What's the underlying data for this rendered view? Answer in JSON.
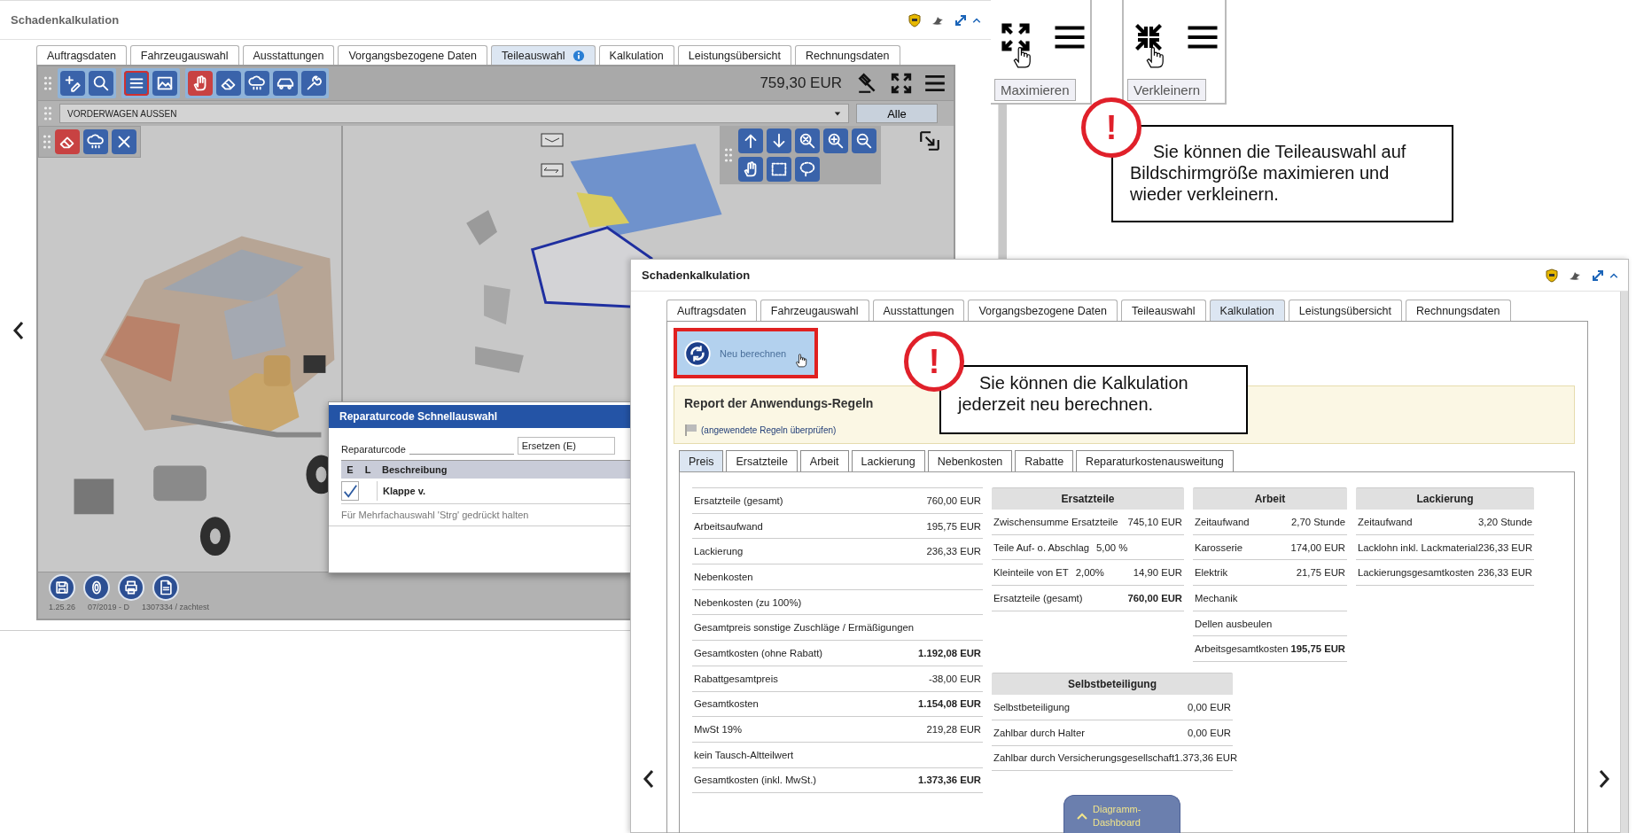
{
  "back_window": {
    "title": "Schadenkalkulation",
    "tabs": [
      {
        "label": "Auftragsdaten",
        "selected": false,
        "info": false
      },
      {
        "label": "Fahrzeugauswahl",
        "selected": false,
        "info": false
      },
      {
        "label": "Ausstattungen",
        "selected": false,
        "info": false
      },
      {
        "label": "Vorgangsbezogene Daten",
        "selected": false,
        "info": false
      },
      {
        "label": "Teileauswahl",
        "selected": true,
        "info": true
      },
      {
        "label": "Kalkulation",
        "selected": false,
        "info": false
      },
      {
        "label": "Leistungsübersicht",
        "selected": false,
        "info": false
      },
      {
        "label": "Rechnungsdaten",
        "selected": false,
        "info": false
      }
    ],
    "toolbar": {
      "groups": [
        {
          "tools": [
            {
              "kind": "add-edit",
              "selected": false,
              "active": false
            },
            {
              "kind": "search",
              "selected": false,
              "active": false
            }
          ]
        },
        {
          "tools": [
            {
              "kind": "list",
              "selected": true,
              "active": false
            },
            {
              "kind": "image",
              "selected": false,
              "active": false
            }
          ]
        },
        {
          "tools": [
            {
              "kind": "hand",
              "selected": false,
              "active": true
            },
            {
              "kind": "eraser",
              "selected": false,
              "active": false
            },
            {
              "kind": "cloud",
              "selected": false,
              "active": false
            },
            {
              "kind": "car",
              "selected": false,
              "active": false
            },
            {
              "kind": "wrench",
              "selected": false,
              "active": false
            }
          ]
        }
      ],
      "total": "759,30 EUR"
    },
    "filter": {
      "value": "VORDERWAGEN AUSSEN",
      "button": "Alle"
    },
    "canvas": {
      "left_tools": [
        {
          "kind": "eraser",
          "selected": false,
          "active": true
        },
        {
          "kind": "cloud",
          "selected": false,
          "active": false
        },
        {
          "kind": "close",
          "selected": false,
          "active": false
        }
      ],
      "view_tools": [
        {
          "kind": "arrow-up",
          "selected": false,
          "active": false
        },
        {
          "kind": "arrow-down",
          "selected": false,
          "active": false
        },
        {
          "kind": "zoom-fit",
          "selected": false,
          "active": false
        },
        {
          "kind": "zoom-in",
          "selected": false,
          "active": false
        },
        {
          "kind": "zoom-out",
          "selected": false,
          "active": false
        },
        {
          "kind": "hand",
          "selected": false,
          "active": false
        },
        {
          "kind": "select-rect",
          "selected": false,
          "active": false
        },
        {
          "kind": "lasso",
          "selected": false,
          "active": false
        }
      ]
    },
    "footer": {
      "tools": [
        {
          "kind": "save"
        },
        {
          "kind": "tire"
        },
        {
          "kind": "print"
        },
        {
          "kind": "document"
        }
      ],
      "status": [
        "1.25.26",
        "07/2019 - D",
        "1307334 / zachtest"
      ]
    },
    "dialog": {
      "title": "Reparaturcode Schnellauswahl",
      "field_label": "Reparaturcode",
      "field_value": "Ersetzen (E)",
      "columns": [
        "E",
        "L",
        "Beschreibung"
      ],
      "rows": [
        {
          "e": true,
          "l": false,
          "description": "Klappe v."
        }
      ],
      "hint": "Für Mehrfachauswahl 'Strg' gedrückt halten"
    }
  },
  "insets": [
    {
      "kind": "maximize",
      "tooltip": "Maximieren"
    },
    {
      "kind": "minimize",
      "tooltip": "Verkleinern"
    }
  ],
  "callouts": [
    {
      "mark": "!",
      "text": "Sie können die Teileauswahl auf Bildschirmgröße maximieren und wieder verkleinern."
    },
    {
      "mark": "!",
      "text": "Sie können die Kalkulation jederzeit neu berechnen."
    }
  ],
  "front_window": {
    "title": "Schadenkalkulation",
    "tabs": [
      {
        "label": "Auftragsdaten",
        "selected": false
      },
      {
        "label": "Fahrzeugauswahl",
        "selected": false
      },
      {
        "label": "Ausstattungen",
        "selected": false
      },
      {
        "label": "Vorgangsbezogene Daten",
        "selected": false
      },
      {
        "label": "Teileauswahl",
        "selected": false
      },
      {
        "label": "Kalkulation",
        "selected": true
      },
      {
        "label": "Leistungsübersicht",
        "selected": false
      },
      {
        "label": "Rechnungsdaten",
        "selected": false
      }
    ],
    "recalc_button": "Neu berechnen",
    "report": {
      "title": "Report der Anwendungs-Regeln",
      "link": "(angewendete Regeln überprüfen)"
    },
    "subtabs": [
      {
        "label": "Preis",
        "selected": true
      },
      {
        "label": "Ersatzteile",
        "selected": false
      },
      {
        "label": "Arbeit",
        "selected": false
      },
      {
        "label": "Lackierung",
        "selected": false
      },
      {
        "label": "Nebenkosten",
        "selected": false
      },
      {
        "label": "Rabatte",
        "selected": false
      },
      {
        "label": "Reparaturkostenausweitung",
        "selected": false
      }
    ],
    "summary": [
      {
        "label": "Ersatzteile (gesamt)",
        "value": "760,00 EUR",
        "bold": false
      },
      {
        "label": "Arbeitsaufwand",
        "value": "195,75 EUR",
        "bold": false
      },
      {
        "label": "Lackierung",
        "value": "236,33 EUR",
        "bold": false
      },
      {
        "label": "Nebenkosten",
        "bold": false
      },
      {
        "label": "Nebenkosten (zu 100%)",
        "bold": false
      },
      {
        "label": "Gesamtpreis sonstige Zuschläge / Ermäßigungen",
        "bold": false
      },
      {
        "label": "Gesamtkosten (ohne Rabatt)",
        "value": "1.192,08 EUR",
        "bold": true
      },
      {
        "label": "Rabattgesamtpreis",
        "value": "-38,00 EUR",
        "bold": false
      },
      {
        "label": "Gesamtkosten",
        "value": "1.154,08 EUR",
        "bold": true
      },
      {
        "label": "MwSt 19%",
        "value": "219,28 EUR",
        "bold": false
      },
      {
        "label": "kein Tausch-Altteilwert",
        "bold": false
      },
      {
        "label": "Gesamtkosten (inkl. MwSt.)",
        "value": "1.373,36 EUR",
        "bold": true
      }
    ],
    "groups": [
      {
        "title": "Ersatzteile",
        "rows": [
          {
            "label": "Zwischensumme Ersatzteile",
            "value": "745,10 EUR",
            "bold": false
          },
          {
            "label": "Teile Auf- o. Abschlag",
            "rate": "5,00 %",
            "bold": false
          },
          {
            "label": "Kleinteile von ET",
            "rate": "2,00%",
            "value": "14,90 EUR",
            "bold": false
          },
          {
            "label": "Ersatzteile (gesamt)",
            "value": "760,00 EUR",
            "bold": true
          }
        ]
      },
      {
        "title": "Arbeit",
        "rows": [
          {
            "label": "Zeitaufwand",
            "value": "2,70 Stunde",
            "bold": false
          },
          {
            "label": "Karosserie",
            "value": "174,00 EUR",
            "bold": false
          },
          {
            "label": "Elektrik",
            "value": "21,75 EUR",
            "bold": false
          },
          {
            "label": "Mechanik",
            "bold": false
          },
          {
            "label": "Dellen ausbeulen",
            "bold": false
          },
          {
            "label": "Arbeitsgesamtkosten",
            "value": "195,75 EUR",
            "bold": true
          }
        ]
      },
      {
        "title": "Lackierung",
        "rows": [
          {
            "label": "Zeitaufwand",
            "value": "3,20 Stunde",
            "bold": false
          },
          {
            "label": "Lacklohn inkl. Lackmaterial",
            "value": "236,33 EUR",
            "bold": false
          },
          {
            "label": "Lackierungsgesamtkosten",
            "value": "236,33 EUR",
            "bold": false
          }
        ]
      }
    ],
    "deductible": {
      "title": "Selbstbeteiligung",
      "rows": [
        {
          "label": "Selbstbeteiligung",
          "value": "0,00 EUR",
          "bold": false
        },
        {
          "label": "Zahlbar durch Halter",
          "value": "0,00 EUR",
          "bold": false
        },
        {
          "label": "Zahlbar durch Versicherungsgesellschaft",
          "value": "1.373,36 EUR",
          "bold": false
        }
      ]
    },
    "dashboard_button": "Diagramm-Dashboard"
  }
}
